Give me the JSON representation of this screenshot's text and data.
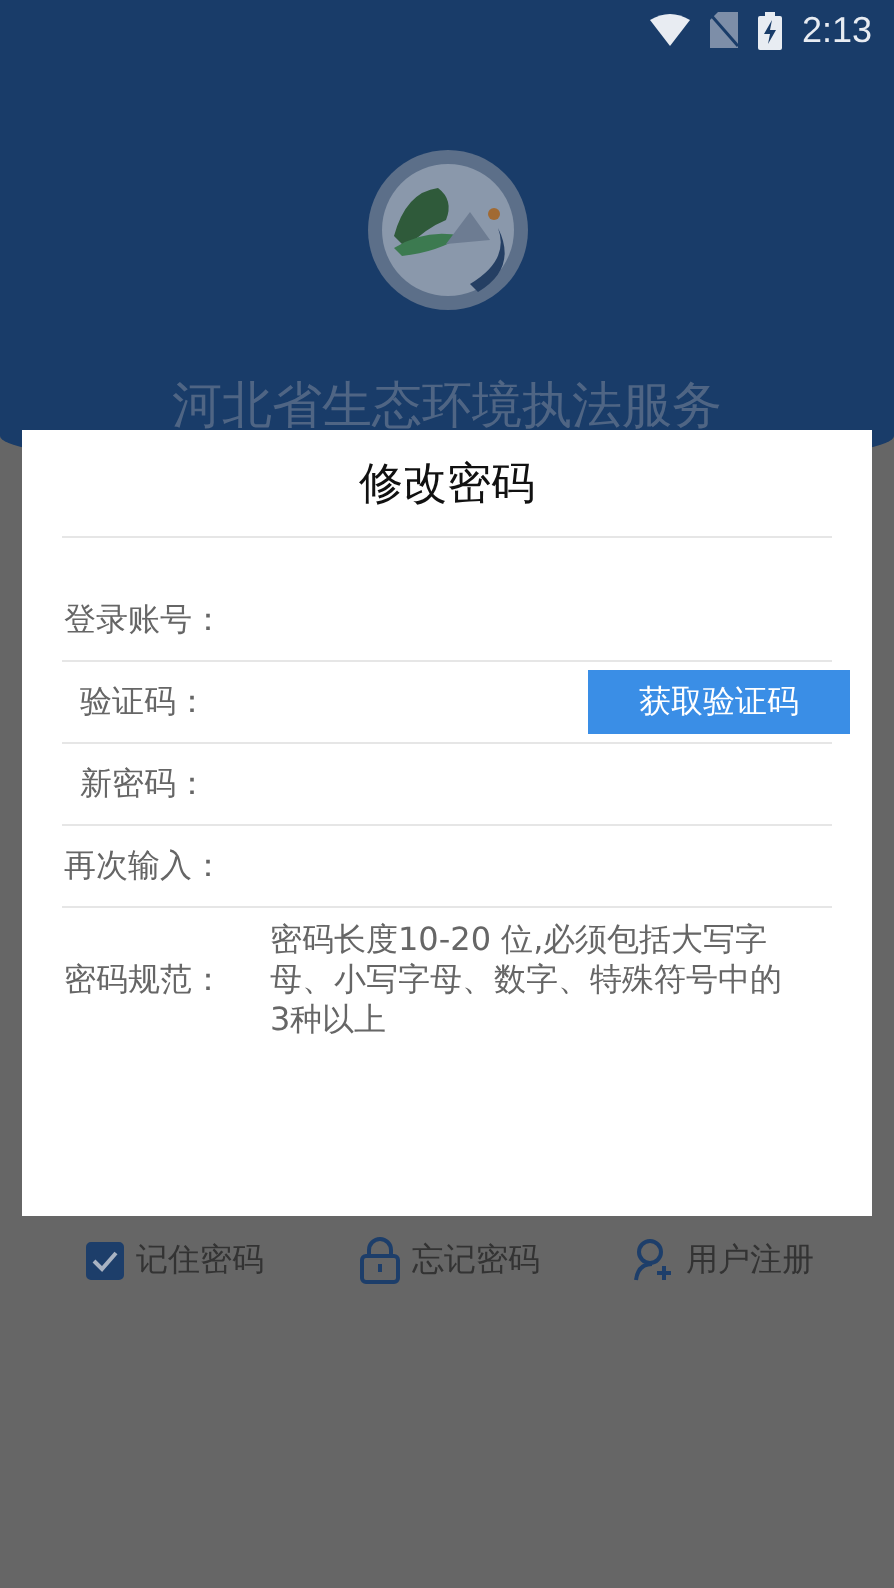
{
  "status_bar": {
    "time": "2:13"
  },
  "app_title": "河北省生态环境执法服务",
  "login_options": [
    {
      "kind": "checkbox",
      "label": "记住密码",
      "checked": true
    },
    {
      "kind": "lock",
      "label": "忘记密码"
    },
    {
      "kind": "user",
      "label": "用户注册"
    }
  ],
  "dialog": {
    "title": "修改密码",
    "fields": [
      {
        "kind": "input",
        "label": "登录账号："
      },
      {
        "kind": "code",
        "label": "验证码：",
        "button": "获取验证码"
      },
      {
        "kind": "input",
        "label": "新密码："
      },
      {
        "kind": "input",
        "label": "再次输入："
      }
    ],
    "rule": {
      "label": "密码规范：",
      "text": "密码长度10-20 位,必须包括大写字母、小写字母、数字、特殊符号中的3种以上"
    }
  }
}
